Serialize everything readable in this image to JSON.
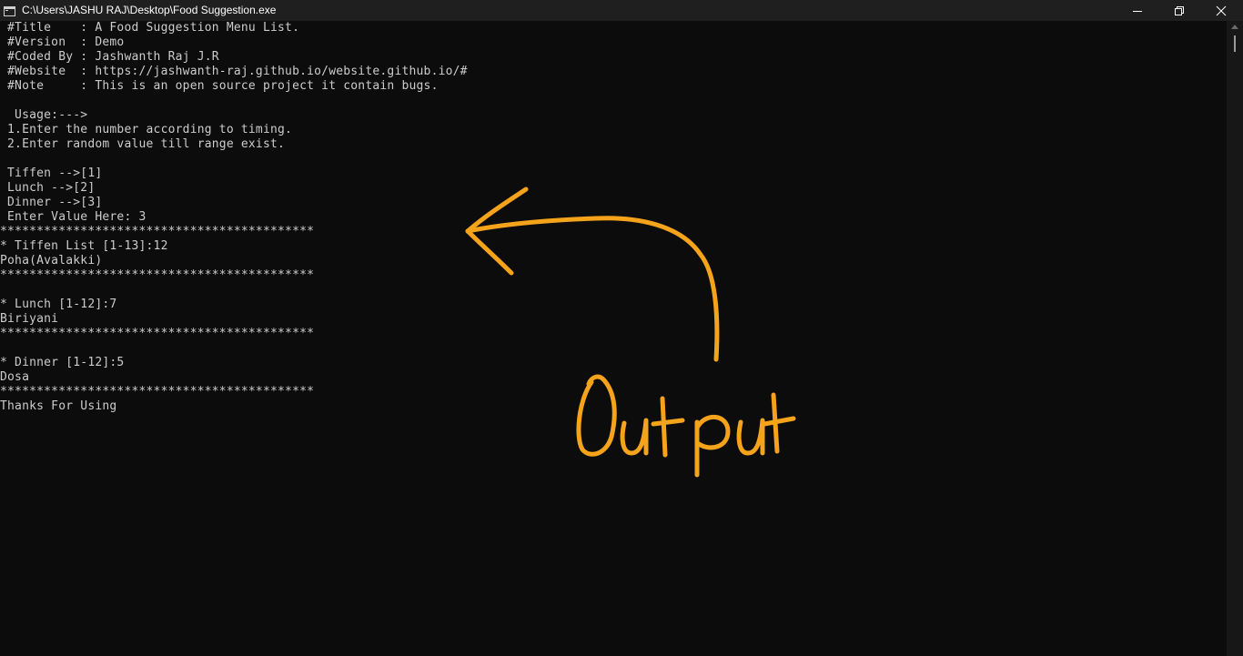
{
  "window": {
    "title": "C:\\Users\\JASHU RAJ\\Desktop\\Food Suggestion.exe",
    "controls": {
      "minimize_icon": "minimize-icon",
      "maximize_icon": "restore-icon",
      "close_icon": "close-icon"
    }
  },
  "console": {
    "lines": [
      " #Title    : A Food Suggestion Menu List.",
      " #Version  : Demo",
      " #Coded By : Jashwanth Raj J.R",
      " #Website  : https://jashwanth-raj.github.io/website.github.io/#",
      " #Note     : This is an open source project it contain bugs.",
      "",
      "  Usage:--->",
      " 1.Enter the number according to timing.",
      " 2.Enter random value till range exist.",
      "",
      " Tiffen -->[1]",
      " Lunch -->[2]",
      " Dinner -->[3]",
      " Enter Value Here: 3",
      "*******************************************",
      "* Tiffen List [1-13]:12",
      "Poha(Avalakki)",
      "*******************************************",
      "",
      "* Lunch [1-12]:7",
      "Biriyani",
      "*******************************************",
      "",
      "* Dinner [1-12]:5",
      "Dosa",
      "*******************************************",
      "Thanks For Using"
    ]
  },
  "annotation": {
    "text": "Output",
    "color": "#f5a31a"
  },
  "colors": {
    "background": "#0c0c0c",
    "titlebar": "#1f1f1f",
    "console_text": "#cccccc",
    "annotation": "#f5a31a"
  }
}
